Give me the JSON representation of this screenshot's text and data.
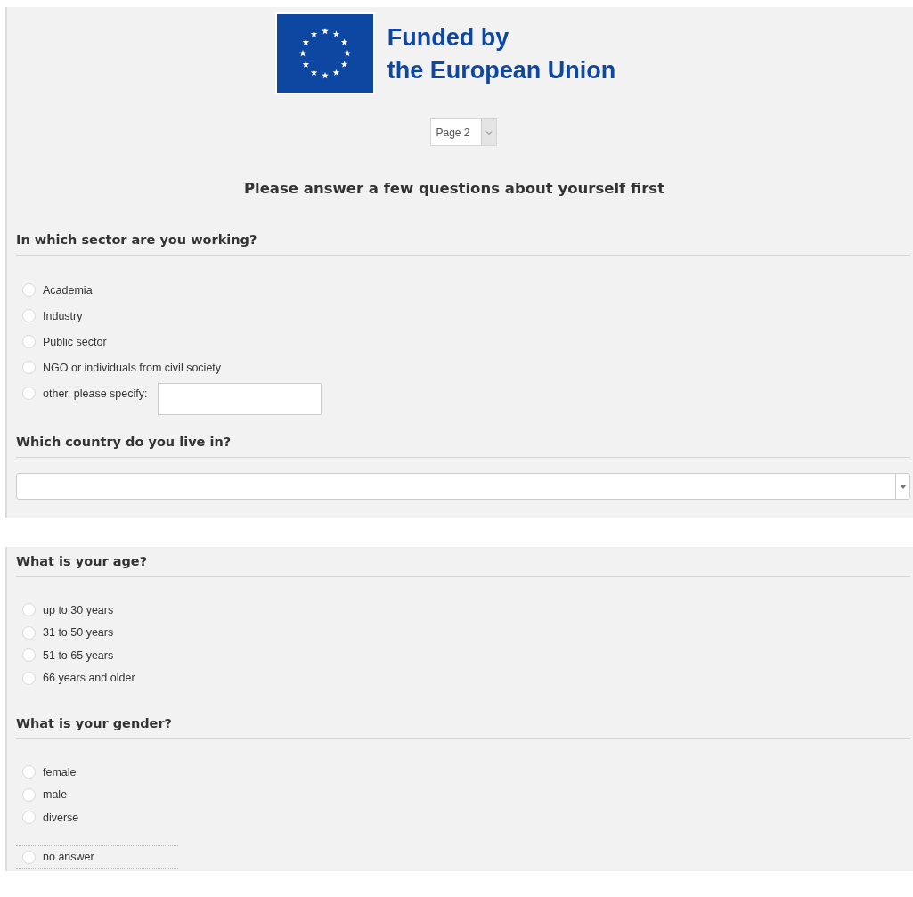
{
  "logo": {
    "line1": "Funded by",
    "line2": "the European Union"
  },
  "page_select": {
    "value": "Page 2"
  },
  "title": "Please answer a few questions about yourself first",
  "panels": [
    {
      "questions": [
        {
          "kind": "radio",
          "heading": "In which sector are you working?",
          "options": [
            {
              "label": "Academia",
              "selected": false,
              "kind": "plain"
            },
            {
              "label": "Industry",
              "selected": false,
              "kind": "plain"
            },
            {
              "label": "Public sector",
              "selected": false,
              "kind": "plain"
            },
            {
              "label": "NGO or individuals from civil society",
              "selected": false,
              "kind": "plain"
            },
            {
              "label": "other, please specify:",
              "selected": false,
              "kind": "other"
            }
          ]
        },
        {
          "kind": "dropdown",
          "heading": "Which country do you live in?"
        }
      ]
    },
    {
      "questions": [
        {
          "kind": "radio",
          "heading": "What is your age?",
          "options": [
            {
              "label": "up to 30 years",
              "selected": false,
              "kind": "plain"
            },
            {
              "label": "31 to 50 years",
              "selected": false,
              "kind": "plain"
            },
            {
              "label": "51 to 65 years",
              "selected": false,
              "kind": "plain"
            },
            {
              "label": "66 years and older",
              "selected": false,
              "kind": "plain"
            }
          ]
        },
        {
          "kind": "radio",
          "heading": "What is your gender?",
          "options": [
            {
              "label": "female",
              "selected": false,
              "kind": "plain"
            },
            {
              "label": "male",
              "selected": false,
              "kind": "plain"
            },
            {
              "label": "diverse",
              "selected": false,
              "kind": "plain"
            },
            {
              "label": "no answer",
              "selected": false,
              "kind": "separate"
            }
          ]
        }
      ]
    }
  ]
}
